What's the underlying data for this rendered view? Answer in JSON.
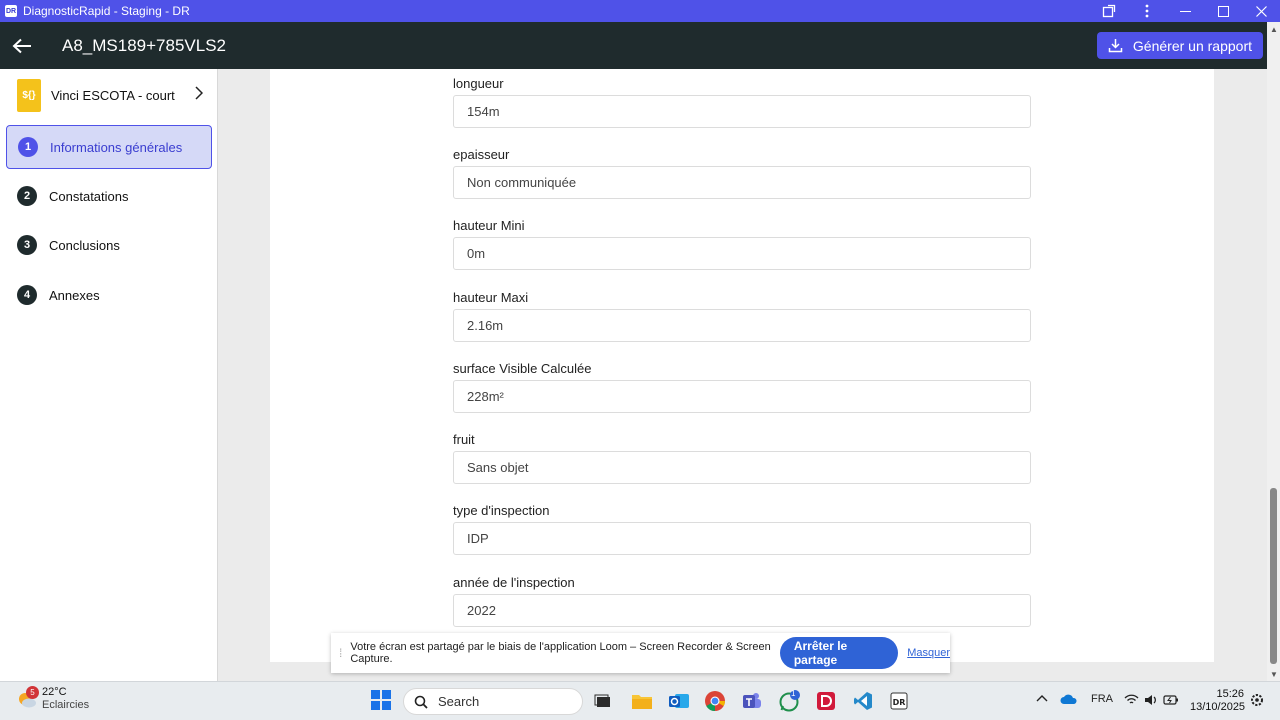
{
  "window": {
    "app_icon_text": "DR",
    "title": "DiagnosticRapid - Staging - DR"
  },
  "header": {
    "title": "A8_MS189+785VLS2",
    "generate_button": "Générer un rapport"
  },
  "sidebar": {
    "project": {
      "icon_text": "${}",
      "name": "Vinci ESCOTA - court"
    },
    "steps": [
      {
        "number": "1",
        "label": "Informations générales",
        "active": true
      },
      {
        "number": "2",
        "label": "Constatations",
        "active": false
      },
      {
        "number": "3",
        "label": "Conclusions",
        "active": false
      },
      {
        "number": "4",
        "label": "Annexes",
        "active": false
      }
    ]
  },
  "form": {
    "fields": [
      {
        "label": "longueur",
        "value": "154m"
      },
      {
        "label": "epaisseur",
        "value": "Non communiquée"
      },
      {
        "label": "hauteur Mini",
        "value": "0m"
      },
      {
        "label": "hauteur Maxi",
        "value": "2.16m"
      },
      {
        "label": "surface Visible Calculée",
        "value": "228m²"
      },
      {
        "label": "fruit",
        "value": "Sans objet"
      },
      {
        "label": "type d'inspection",
        "value": "IDP"
      },
      {
        "label": "année de l'inspection",
        "value": "2022"
      }
    ]
  },
  "loom_banner": {
    "message": "Votre écran est partagé par le biais de l'application Loom – Screen Recorder & Screen Capture.",
    "stop_button": "Arrêter le partage",
    "hide_link": "Masquer"
  },
  "taskbar": {
    "weather": {
      "badge": "5",
      "temperature": "22°C",
      "condition": "Eclaircies"
    },
    "search_label": "Search",
    "whatsapp_badge": "1",
    "language": "FRA",
    "time": "15:26",
    "date": "13/10/2025"
  },
  "colors": {
    "accent": "#4f52e8",
    "header_bg": "#1f2b2d",
    "active_step_bg": "#d5d9f7",
    "loom_blue": "#2f63d6"
  }
}
